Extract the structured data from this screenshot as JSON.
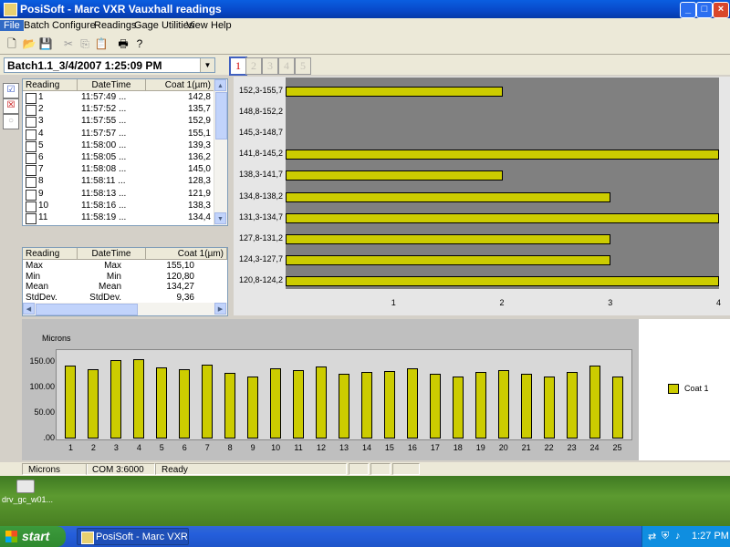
{
  "window": {
    "title": "PosiSoft - Marc VXR Vauxhall readings",
    "min_glyph": "_",
    "max_glyph": "□",
    "close_glyph": "×"
  },
  "menu": [
    "File",
    "Batch",
    "Configure",
    "Readings",
    "Gage Utilities",
    "View",
    "Help"
  ],
  "toolbar_icons": [
    "new-icon",
    "open-icon",
    "save-icon",
    "cut-icon",
    "copy-icon",
    "paste-icon",
    "print-icon",
    "help-icon"
  ],
  "batch": {
    "selected": "Batch1.1_3/4/2007 1:25:09 PM",
    "channels": [
      "1",
      "2",
      "3",
      "4",
      "5"
    ]
  },
  "readings_grid": {
    "headers": [
      "Reading",
      "DateTime",
      "Coat 1(µm)"
    ],
    "rows": [
      {
        "n": "1",
        "time": "11:57:49 ...",
        "val": "142,8"
      },
      {
        "n": "2",
        "time": "11:57:52 ...",
        "val": "135,7"
      },
      {
        "n": "3",
        "time": "11:57:55 ...",
        "val": "152,9"
      },
      {
        "n": "4",
        "time": "11:57:57 ...",
        "val": "155,1"
      },
      {
        "n": "5",
        "time": "11:58:00 ...",
        "val": "139,3"
      },
      {
        "n": "6",
        "time": "11:58:05 ...",
        "val": "136,2"
      },
      {
        "n": "7",
        "time": "11:58:08 ...",
        "val": "145,0"
      },
      {
        "n": "8",
        "time": "11:58:11 ...",
        "val": "128,3"
      },
      {
        "n": "9",
        "time": "11:58:13 ...",
        "val": "121,9"
      },
      {
        "n": "10",
        "time": "11:58:16 ...",
        "val": "138,3"
      },
      {
        "n": "11",
        "time": "11:58:19 ...",
        "val": "134,4"
      }
    ]
  },
  "stats_grid": {
    "headers": [
      "Reading",
      "DateTime",
      "Coat 1(µm)"
    ],
    "rows": [
      {
        "a": "Max",
        "b": "Max",
        "c": "155,10"
      },
      {
        "a": "Min",
        "b": "Min",
        "c": "120,80"
      },
      {
        "a": "Mean",
        "b": "Mean",
        "c": "134,27"
      },
      {
        "a": "StdDev.",
        "b": "StdDev.",
        "c": "9,36"
      }
    ]
  },
  "chart_data": [
    {
      "type": "bar",
      "orientation": "horizontal",
      "categories": [
        "152,3-155,7",
        "148,8-152,2",
        "145,3-148,7",
        "141,8-145,2",
        "138,3-141,7",
        "134,8-138,2",
        "131,3-134,7",
        "127,8-131,2",
        "124,3-127,7",
        "120,8-124,2"
      ],
      "values": [
        2,
        0,
        0,
        4,
        2,
        3,
        4,
        3,
        3,
        4
      ],
      "xticks": [
        "1",
        "2",
        "3",
        "4"
      ],
      "xlim": [
        0,
        4
      ]
    },
    {
      "type": "bar",
      "ylabel": "Microns",
      "categories": [
        "1",
        "2",
        "3",
        "4",
        "5",
        "6",
        "7",
        "8",
        "9",
        "10",
        "11",
        "12",
        "13",
        "14",
        "15",
        "16",
        "17",
        "18",
        "19",
        "20",
        "21",
        "22",
        "23",
        "24",
        "25"
      ],
      "series": [
        {
          "name": "Coat 1",
          "values": [
            142.8,
            135.7,
            152.9,
            155.1,
            139.3,
            136.2,
            145.0,
            128.3,
            121.9,
            138.3,
            134.4,
            141.0,
            127.0,
            130.0,
            133.0,
            137.0,
            126.0,
            121.0,
            131.0,
            134.0,
            126.0,
            121.0,
            131.0,
            143.0,
            120.8
          ]
        }
      ],
      "yticks": [
        "150.00",
        "100.00",
        "50.00",
        ".00"
      ],
      "ylim": [
        0,
        175
      ],
      "legend": "right",
      "color": "#cccc00"
    }
  ],
  "status": {
    "unit": "Microns",
    "port": "COM 3:6000",
    "state": "Ready"
  },
  "desktop": {
    "icon_label": "drv_gc_w01..."
  },
  "taskbar": {
    "start": "start",
    "task": "PosiSoft - Marc VXR V...",
    "clock": "1:27 PM"
  }
}
